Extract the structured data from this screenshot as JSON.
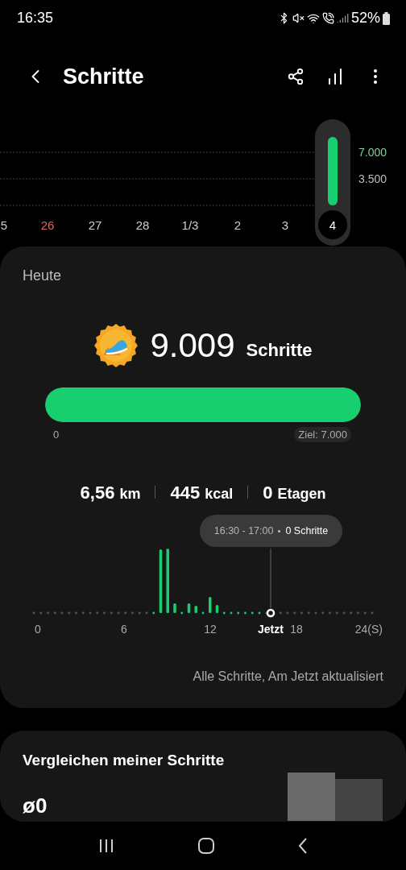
{
  "status_bar": {
    "time": "16:35",
    "battery": "52%"
  },
  "header": {
    "title": "Schritte"
  },
  "week_chart": {
    "y_labels": [
      {
        "label": "7.000",
        "color": "#7ed39a"
      },
      {
        "label": "3.500",
        "color": "#bdbdbd"
      }
    ],
    "days": [
      {
        "label": "5",
        "selected": false,
        "color": "#cfcfcf"
      },
      {
        "label": "26",
        "selected": false,
        "color": "#e0675c"
      },
      {
        "label": "27",
        "selected": false,
        "color": "#cfcfcf"
      },
      {
        "label": "28",
        "selected": false,
        "color": "#cfcfcf"
      },
      {
        "label": "1/3",
        "selected": false,
        "color": "#cfcfcf"
      },
      {
        "label": "2",
        "selected": false,
        "color": "#cfcfcf"
      },
      {
        "label": "3",
        "selected": false,
        "color": "#cfcfcf"
      },
      {
        "label": "4",
        "selected": true,
        "color": "#ffffff"
      }
    ]
  },
  "today": {
    "title": "Heute",
    "steps": "9.009",
    "steps_unit": "Schritte",
    "level": 1,
    "min_label": "0",
    "goal_label": "Ziel: 7.000",
    "stats": [
      {
        "value": "6,56",
        "unit": "km"
      },
      {
        "value": "445",
        "unit": "kcal"
      },
      {
        "value": "0",
        "unit": "Etagen"
      }
    ],
    "tooltip": {
      "time": "16:30 - 17:00",
      "steps": "0 Schritte"
    },
    "axis_labels": [
      {
        "text": "0",
        "kind": "tick"
      },
      {
        "text": "6",
        "kind": "tick"
      },
      {
        "text": "12",
        "kind": "tick"
      },
      {
        "text": "Jetzt",
        "kind": "now"
      },
      {
        "text": "18",
        "kind": "tick"
      },
      {
        "text": "24(S)",
        "kind": "tick"
      }
    ],
    "footer": "Alle Schritte, Am Jetzt aktualisiert"
  },
  "compare": {
    "title": "Vergleichen meiner Schritte",
    "average": "ø0"
  }
}
